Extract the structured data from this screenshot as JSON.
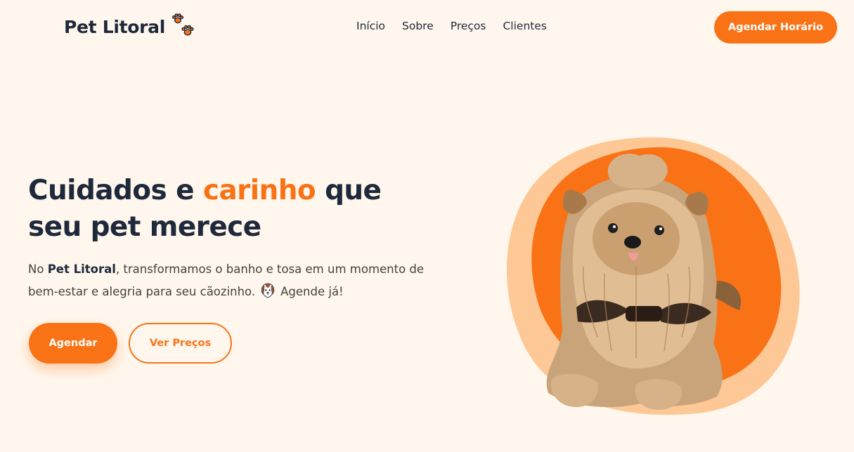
{
  "header": {
    "brand": "Pet Litoral",
    "nav": [
      {
        "label": "Início"
      },
      {
        "label": "Sobre"
      },
      {
        "label": "Preços"
      },
      {
        "label": "Clientes"
      }
    ],
    "cta_label": "Agendar Horário"
  },
  "hero": {
    "title_part1": "Cuidados e ",
    "title_accent": "carinho",
    "title_part2": " que seu pet merece",
    "desc_prefix": "No ",
    "desc_brand": "Pet Litoral",
    "desc_middle": ", transformamos o banho e tosa em um momento de bem-estar e alegria para seu cãozinho.",
    "desc_suffix": "Agende já!",
    "primary_button": "Agendar",
    "secondary_button": "Ver Preços"
  },
  "icons": {
    "logo": "paw-prints-icon",
    "inline": "dog-face-icon",
    "hero_image": "yorkshire-dog-photo"
  },
  "colors": {
    "accent": "#f97316",
    "accent_light": "#fdc896",
    "background": "#fff7ed",
    "text_dark": "#1e293b"
  }
}
